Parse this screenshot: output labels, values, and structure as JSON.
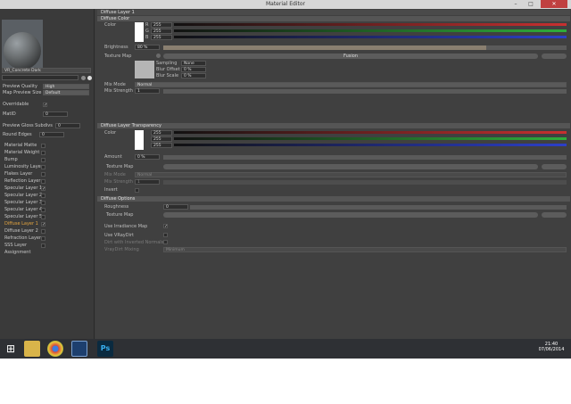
{
  "window": {
    "title": "Material Editor",
    "buttons": [
      "–",
      "□",
      "✕"
    ]
  },
  "left": {
    "material_name": "VR_Concrete Dark",
    "preview_quality_label": "Preview Quality",
    "preview_quality_value": "High",
    "map_preview_size_label": "Map Preview Size",
    "map_preview_size_value": "Default",
    "overridable_label": "Overridable",
    "matid_label": "MatID",
    "matid_value": "0",
    "preview_gloss_label": "Preview Gloss Subdivs",
    "preview_gloss_value": "0",
    "round_edges_label": "Round Edges",
    "round_edges_value": "0",
    "channels": [
      {
        "label": "Material Matte",
        "checked": false
      },
      {
        "label": "Material Weight",
        "checked": false
      },
      {
        "label": "Bump",
        "checked": false
      },
      {
        "label": "Luminosity Layer",
        "checked": false
      },
      {
        "label": "Flakes Layer",
        "checked": false
      },
      {
        "label": "Reflection Layer",
        "checked": false
      },
      {
        "label": "Specular Layer 1",
        "checked": true
      },
      {
        "label": "Specular Layer 2",
        "checked": false
      },
      {
        "label": "Specular Layer 3",
        "checked": false
      },
      {
        "label": "Specular Layer 4",
        "checked": false
      },
      {
        "label": "Specular Layer 5",
        "checked": false
      },
      {
        "label": "Diffuse Layer 1",
        "checked": true,
        "active": true
      },
      {
        "label": "Diffuse Layer 2",
        "checked": false
      },
      {
        "label": "Refraction Layer",
        "checked": false
      },
      {
        "label": "SSS Layer",
        "checked": false
      },
      {
        "label": "Assignment",
        "checked": null
      }
    ]
  },
  "right": {
    "title": "Diffuse Layer 1",
    "diffuse_color_header": "Diffuse Color",
    "color_label": "Color",
    "r": "255",
    "g": "255",
    "b": "255",
    "r_label": "R",
    "g_label": "G",
    "b_label": "B",
    "brightness_label": "Brightness",
    "brightness_value": "80 %",
    "brightness_fraction": 0.8,
    "texture_map_label": "Texture Map",
    "texture_map_value": "Fusion",
    "sampling_label": "Sampling",
    "sampling_value": "None",
    "blur_offset_label": "Blur Offset",
    "blur_offset_value": "0 %",
    "blur_scale_label": "Blur Scale",
    "blur_scale_value": "0 %",
    "mix_mode_label": "Mix Mode",
    "mix_mode_value": "Normal",
    "mix_strength_label": "Mix Strength",
    "mix_strength_value": "1",
    "transparency_header": "Diffuse Layer Transparency",
    "t_color_label": "Color",
    "t_r": "255",
    "t_g": "255",
    "t_b": "255",
    "amount_label": "Amount",
    "amount_value": "0 %",
    "t_texture_label": "Texture Map",
    "t_mix_mode_label": "Mix Mode",
    "t_mix_mode_value": "Normal",
    "t_mix_strength_label": "Mix Strength",
    "t_mix_strength_value": "1",
    "invert_label": "Invert",
    "options_header": "Diffuse Options",
    "roughness_label": "Roughness",
    "roughness_value": "0",
    "o_texture_label": "Texture Map",
    "irradiance_label": "Use Irradiance Map",
    "vraydirt_label": "Use VRayDirt",
    "dirt_inverted_label": "Dirt with Inverted Normals",
    "dirt_mixing_label": "VrayDirt Mixing",
    "dirt_mixing_value": "Minimum"
  },
  "taskbar": {
    "time": "21:40",
    "date": "07/06/2014",
    "apps": [
      "start",
      "explorer",
      "chrome",
      "cinema4d",
      "photoshop"
    ],
    "ps_label": "Ps"
  },
  "colors": {
    "red": "#c83030",
    "green": "#2fae3a",
    "blue": "#2c3fc8",
    "active": "#e6a640"
  }
}
